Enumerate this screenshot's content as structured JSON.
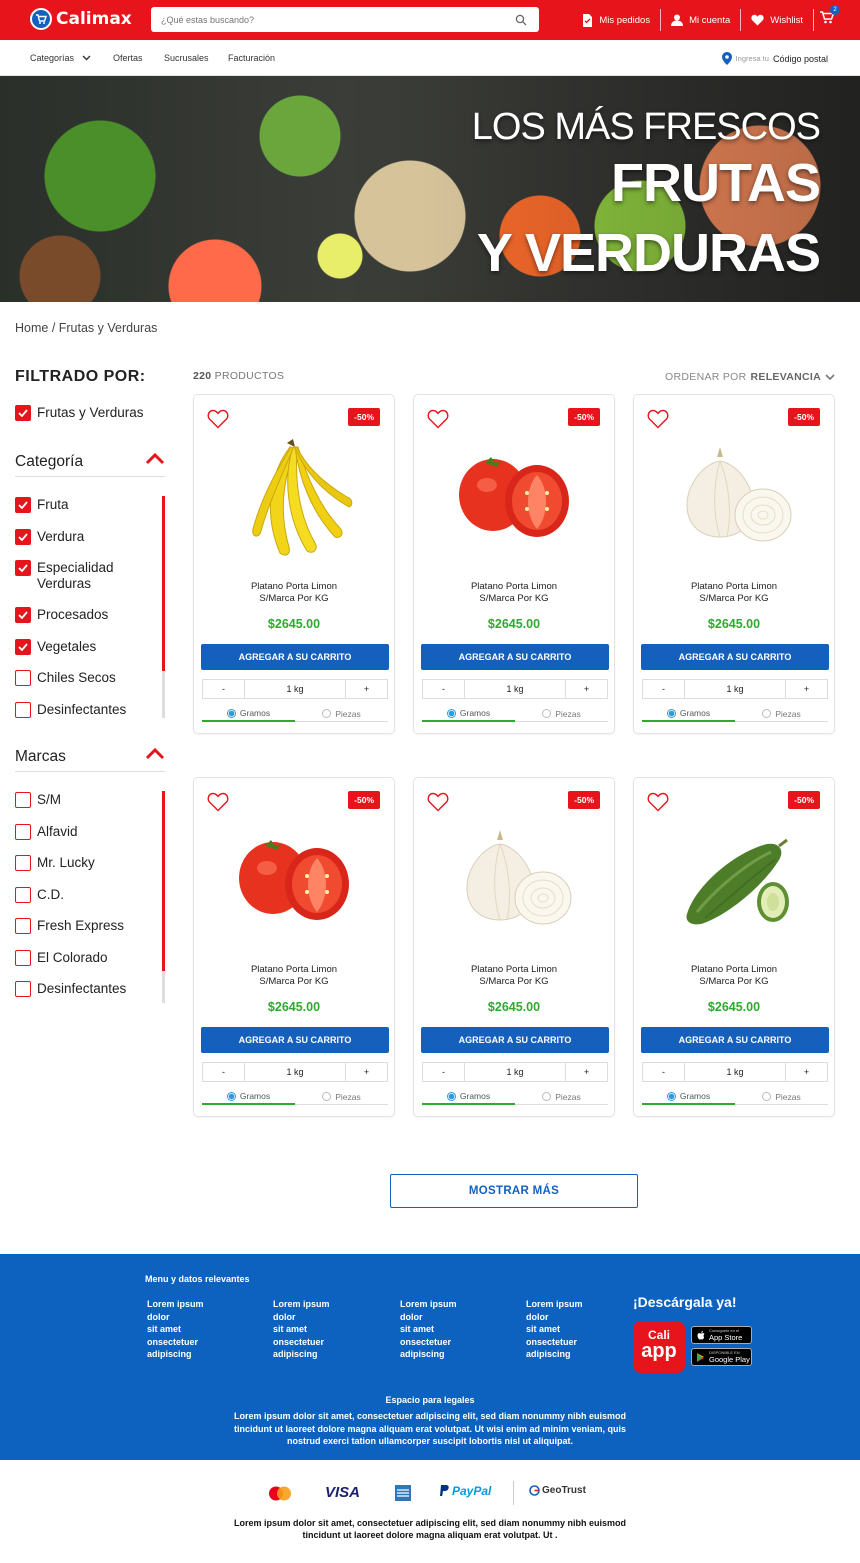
{
  "header": {
    "logo": "Calimax",
    "search_placeholder": "¿Qué estas buscando?",
    "orders": "Mis pedidos",
    "account": "Mi cuenta",
    "wishlist": "Wishlist",
    "cart_count": "2"
  },
  "subnav": {
    "categories": "Categorías",
    "offers": "Ofertas",
    "branches": "Sucrusales",
    "billing": "Facturación",
    "postal_hint": "Ingresa tu",
    "postal_label": "Código postal"
  },
  "banner": {
    "line1": "LOS MÁS FRESCOS",
    "line2": "FRUTAS",
    "line3": "Y VERDURAS"
  },
  "breadcrumb": "Home / Frutas y Verduras",
  "filters": {
    "title": "FILTRADO POR:",
    "active": "Frutas y Verduras",
    "category_title": "Categoría",
    "categories": [
      {
        "label": "Fruta",
        "checked": true
      },
      {
        "label": "Verdura",
        "checked": true
      },
      {
        "label": "Especialidad Verduras",
        "checked": true
      },
      {
        "label": "Procesados",
        "checked": true
      },
      {
        "label": "Vegetales",
        "checked": true
      },
      {
        "label": "Chiles Secos",
        "checked": false
      },
      {
        "label": "Desinfectantes",
        "checked": false
      }
    ],
    "brands_title": "Marcas",
    "brands": [
      {
        "label": "S/M",
        "checked": false
      },
      {
        "label": "Alfavid",
        "checked": false
      },
      {
        "label": "Mr. Lucky",
        "checked": false
      },
      {
        "label": "C.D.",
        "checked": false
      },
      {
        "label": "Fresh Express",
        "checked": false
      },
      {
        "label": "El Colorado",
        "checked": false
      },
      {
        "label": "Desinfectantes",
        "checked": false
      }
    ]
  },
  "listing": {
    "count_number": "220",
    "count_label": "PRODUCTOS",
    "sort_label": "ORDENAR POR",
    "sort_value": "RELEVANCIA"
  },
  "products": [
    {
      "image": "banana",
      "discount": "-50%",
      "name_line1": "Platano Porta Limon",
      "name_line2": "S/Marca Por KG",
      "price": "$2645.00",
      "button": "AGREGAR A SU CARRITO",
      "minus": "-",
      "qty": "1 kg",
      "plus": "+",
      "unit1": "Gramos",
      "unit2": "Piezas"
    },
    {
      "image": "tomato",
      "discount": "-50%",
      "name_line1": "Platano Porta Limon",
      "name_line2": "S/Marca Por KG",
      "price": "$2645.00",
      "button": "AGREGAR A SU CARRITO",
      "minus": "-",
      "qty": "1 kg",
      "plus": "+",
      "unit1": "Gramos",
      "unit2": "Piezas"
    },
    {
      "image": "onion",
      "discount": "-50%",
      "name_line1": "Platano Porta Limon",
      "name_line2": "S/Marca Por KG",
      "price": "$2645.00",
      "button": "AGREGAR A SU CARRITO",
      "minus": "-",
      "qty": "1 kg",
      "plus": "+",
      "unit1": "Gramos",
      "unit2": "Piezas"
    },
    {
      "image": "tomato",
      "discount": "-50%",
      "name_line1": "Platano Porta Limon",
      "name_line2": "S/Marca Por KG",
      "price": "$2645.00",
      "button": "AGREGAR A SU CARRITO",
      "minus": "-",
      "qty": "1 kg",
      "plus": "+",
      "unit1": "Gramos",
      "unit2": "Piezas"
    },
    {
      "image": "onion",
      "discount": "-50%",
      "name_line1": "Platano Porta Limon",
      "name_line2": "S/Marca Por KG",
      "price": "$2645.00",
      "button": "AGREGAR A SU CARRITO",
      "minus": "-",
      "qty": "1 kg",
      "plus": "+",
      "unit1": "Gramos",
      "unit2": "Piezas"
    },
    {
      "image": "zucchini",
      "discount": "-50%",
      "name_line1": "Platano Porta Limon",
      "name_line2": "S/Marca Por KG",
      "price": "$2645.00",
      "button": "AGREGAR A SU CARRITO",
      "minus": "-",
      "qty": "1 kg",
      "plus": "+",
      "unit1": "Gramos",
      "unit2": "Piezas"
    }
  ],
  "show_more": "MOSTRAR MÁS",
  "footer": {
    "menu_title": "Menu y datos relevantes",
    "columns": [
      [
        "Lorem ipsum",
        "dolor",
        "sit amet",
        "onsectetuer",
        "adipiscing"
      ],
      [
        "Lorem ipsum",
        "dolor",
        "sit amet",
        "onsectetuer",
        "adipiscing"
      ],
      [
        "Lorem ipsum",
        "dolor",
        "sit amet",
        "onsectetuer",
        "adipiscing"
      ],
      [
        "Lorem ipsum",
        "dolor",
        "sit amet",
        "onsectetuer",
        "adipiscing"
      ]
    ],
    "download_title": "¡Descárgala ya!",
    "app_line1": "Cali",
    "app_line2": "app",
    "appstore_small": "Consíguelo en el",
    "appstore": "App Store",
    "googleplay_small": "DISPONIBLE EN",
    "googleplay": "Google Play",
    "legal_title": "Espacio para legales",
    "legal_text": "Lorem ipsum dolor sit amet, consectetuer adipiscing elit, sed diam nonummy nibh euismod tincidunt ut laoreet dolore magna aliquam erat volutpat. Ut wisi enim ad minim veniam, quis nostrud exerci tation ullamcorper suscipit lobortis nisl ut aliquipat."
  },
  "payments": {
    "visa": "VISA",
    "paypal": "PayPal",
    "geotrust": "GeoTrust"
  },
  "bottom_legal": "Lorem ipsum dolor sit amet, consectetuer adipiscing elit, sed diam nonummy nibh euismod tincidunt ut laoreet dolore magna aliquam erat volutpat. Ut .",
  "colors": {
    "brand_red": "#e8141b",
    "brand_blue": "#1560bd",
    "price_green": "#2eaa2e"
  }
}
